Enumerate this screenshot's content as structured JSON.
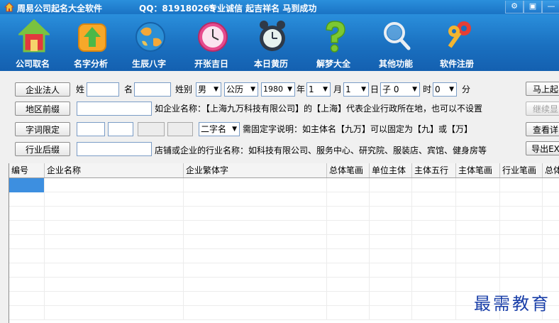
{
  "title_bar": {
    "app_name": "周易公司起名大全软件",
    "qq": "QQ：819180265",
    "slogan": "专业诚信 起吉祥名 马到成功",
    "controls": [
      "⚙",
      "▣",
      "—"
    ]
  },
  "toolbar": {
    "items": [
      {
        "label": "公司取名",
        "icon": "house-icon"
      },
      {
        "label": "名字分析",
        "icon": "upload-arrow-icon"
      },
      {
        "label": "生辰八字",
        "icon": "globe-icon"
      },
      {
        "label": "开张吉日",
        "icon": "clock-icon"
      },
      {
        "label": "本日黄历",
        "icon": "alarm-clock-icon"
      },
      {
        "label": "解梦大全",
        "icon": "question-mark-icon"
      },
      {
        "label": "其他功能",
        "icon": "magnifier-icon"
      },
      {
        "label": "软件注册",
        "icon": "keys-icon"
      }
    ]
  },
  "form": {
    "row1": {
      "button": "企业法人",
      "surname_label": "姓",
      "given_label": "名",
      "gender_label": "姓别",
      "gender_value": "男",
      "calendar_value": "公历",
      "year_value": "1980",
      "year_label": "年",
      "month_value": "1",
      "month_label": "月",
      "day_value": "1",
      "day_label": "日",
      "hour_value": "子 0",
      "hour_label": "时",
      "minute_value": "0",
      "minute_label": "分",
      "action_button": "马上起"
    },
    "row2": {
      "button": "地区前缀",
      "hint": "如企业名称：【上海九万科技有限公司】的【上海】代表企业行政所在地，也可以不设置",
      "action_button": "继续显"
    },
    "row3": {
      "button": "字词限定",
      "select_value": "二字名",
      "hint": "需固定字说明：如主体名【九万】可以固定为【九】或【万】",
      "action_button": "查看详"
    },
    "row4": {
      "button": "行业后缀",
      "hint": "店铺或企业的行业名称：如科技有限公司、服务中心、研究院、服装店、宾馆、健身房等",
      "action_button": "导出EX"
    }
  },
  "grid": {
    "columns": [
      "编号",
      "企业名称",
      "企业繁体字",
      "总体笔画",
      "单位主体",
      "主体五行",
      "主体笔画",
      "行业笔画",
      "总体"
    ]
  },
  "watermark": "最需教育",
  "colors": {
    "titlebar": "#1a73c4",
    "toolbar": "#1a70c0",
    "selected_cell": "#3d8fe0",
    "watermark": "#1a3fa8"
  }
}
